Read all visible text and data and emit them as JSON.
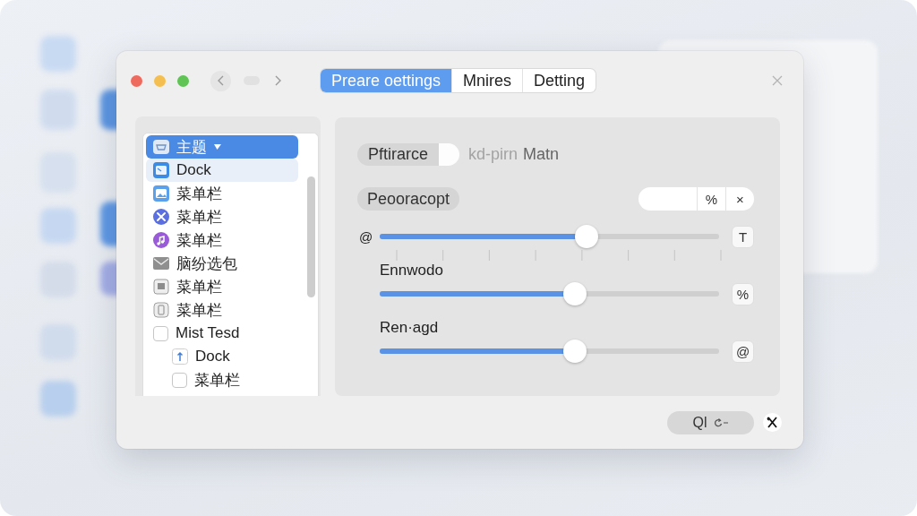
{
  "window": {
    "tabs": [
      {
        "label": "Preare oettings",
        "selected": true
      },
      {
        "label": "Mnires",
        "selected": false
      },
      {
        "label": "Detting",
        "selected": false
      }
    ]
  },
  "sidebar": {
    "items": [
      {
        "kind": "dropdown",
        "label": "主题",
        "selected": true,
        "highlighted": false
      },
      {
        "kind": "icon",
        "label": "Dock",
        "selected": false,
        "highlighted": true
      },
      {
        "kind": "icon",
        "label": "菜单栏",
        "selected": false,
        "highlighted": false
      },
      {
        "kind": "icon",
        "label": "菜单栏",
        "selected": false,
        "highlighted": false
      },
      {
        "kind": "icon",
        "label": "菜单栏",
        "selected": false,
        "highlighted": false
      },
      {
        "kind": "icon",
        "label": "脑纷选包",
        "selected": false,
        "highlighted": false
      },
      {
        "kind": "icon",
        "label": "菜单栏",
        "selected": false,
        "highlighted": false
      },
      {
        "kind": "icon",
        "label": "菜单栏",
        "selected": false,
        "highlighted": false
      },
      {
        "kind": "checkbox",
        "label": "Mist Tesd",
        "checked": false,
        "selected": false,
        "highlighted": false,
        "children": [
          {
            "kind": "icon",
            "label": "Dock",
            "selected": false,
            "highlighted": false
          },
          {
            "kind": "checkbox",
            "label": "菜单栏",
            "checked": false,
            "selected": false,
            "highlighted": false
          }
        ]
      }
    ]
  },
  "panel": {
    "rows": [
      {
        "kind": "switch",
        "label": "Pftirarce",
        "on": true,
        "hint": "kd-pirn",
        "value": "Matn"
      },
      {
        "kind": "field",
        "label": "Peooracopt",
        "buttons": [
          "%",
          "×"
        ]
      },
      {
        "kind": "slider",
        "lead": "@",
        "level": 0.61,
        "end": "T",
        "ticks": true
      },
      {
        "kind": "slider",
        "title": "Ennwodo",
        "level": 0.575,
        "end": "%"
      },
      {
        "kind": "slider",
        "title": "Ren·agd",
        "level": 0.575,
        "end": "@"
      }
    ]
  },
  "footer": {
    "button": "Ql"
  }
}
